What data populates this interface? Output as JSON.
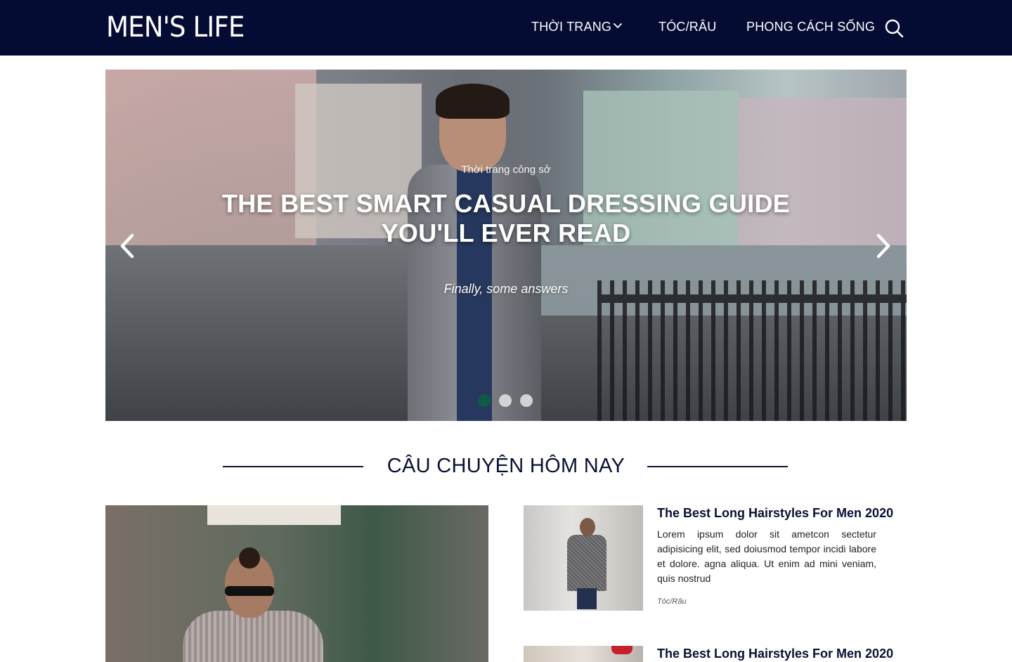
{
  "header": {
    "logo": "MEN'S LIFE",
    "nav": [
      {
        "label": "THỜI TRANG",
        "has_dropdown": true
      },
      {
        "label": "TÓC/RÂU"
      },
      {
        "label": "PHONG CÁCH SỐNG"
      }
    ],
    "search_icon": "search-icon"
  },
  "hero": {
    "category": "Thời trang công sở",
    "title_line1": "THE BEST SMART CASUAL DRESSING GUIDE",
    "title_line2": "YOU'LL EVER READ",
    "subtitle": "Finally, some answers",
    "slide_count": 3,
    "active_slide": 1,
    "active_dot_color": "#0f5b45"
  },
  "section": {
    "title": "CÂU CHUYỆN HÔM NAY"
  },
  "articles": [
    {
      "title": "The Best Long Hairstyles For Men 2020",
      "body": "Lorem ipsum dolor sit ametcon sectetur adipisicing elit, sed doiusmod tempor incidi labore et dolore. agna aliqua. Ut enim ad mini veniam, quis nostrud",
      "tag": "Tóc/Râu"
    },
    {
      "title": "The Best Long Hairstyles For Men 2020"
    }
  ],
  "colors": {
    "header_bg": "#050c33",
    "text_dark": "#0a1033"
  }
}
